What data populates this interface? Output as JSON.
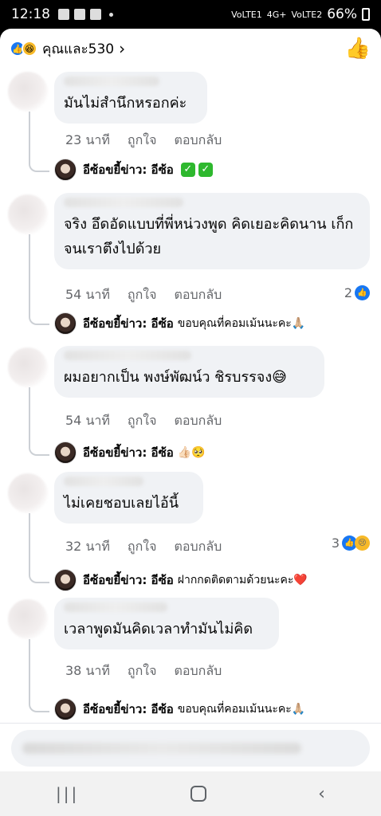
{
  "status_bar": {
    "time": "12:18",
    "network1": "VoLTE1",
    "network_type": "4G+",
    "network2": "VoLTE2",
    "battery": "66%"
  },
  "header": {
    "reactions_label": "คุณและ530"
  },
  "comments": [
    {
      "text": "มันไม่สำนึกหรอกค่ะ",
      "time": "23 นาที",
      "like": "ถูกใจ",
      "reply": "ตอบกลับ",
      "reaction_count": "",
      "author_reply": {
        "name": "อีซ้อขยี้ข่าว: อีซ้อ",
        "text": ""
      }
    },
    {
      "text": "จริง อึดอัดแบบที่พี่หน่วงพูด คิดเยอะคิดนาน เก็กจนเราตึงไปด้วย",
      "time": "54 นาที",
      "like": "ถูกใจ",
      "reply": "ตอบกลับ",
      "reaction_count": "2",
      "author_reply": {
        "name": "อีซ้อขยี้ข่าว: อีซ้อ",
        "text": "ขอบคุณที่คอมเม้นนะคะ🙏🏼"
      }
    },
    {
      "text": "ผมอยากเป็น พงษ์พัฒน์ว ชิรบรรจง😅",
      "time": "54 นาที",
      "like": "ถูกใจ",
      "reply": "ตอบกลับ",
      "reaction_count": "",
      "author_reply": {
        "name": "อีซ้อขยี้ข่าว: อีซ้อ",
        "text": "👍🏻🥺"
      }
    },
    {
      "text": "ไม่เคยชอบเลยไอ้นี้",
      "time": "32 นาที",
      "like": "ถูกใจ",
      "reply": "ตอบกลับ",
      "reaction_count": "3",
      "author_reply": {
        "name": "อีซ้อขยี้ข่าว: อีซ้อ",
        "text": "ฝากกดติดตามด้วยนะคะ❤️"
      }
    },
    {
      "text": "เวลาพูดมันคิดเวลาทำมันไม่คิด",
      "time": "38 นาที",
      "like": "ถูกใจ",
      "reply": "ตอบกลับ",
      "reaction_count": "",
      "author_reply": {
        "name": "อีซ้อขยี้ข่าว: อีซ้อ",
        "text": "ขอบคุณที่คอมเม้นนะคะ🙏🏼"
      }
    }
  ],
  "icons": {
    "like": "thumbs-up-icon",
    "haha": "haha-emoji-icon",
    "sad": "sad-emoji-icon",
    "check": "check-mark-icon"
  },
  "colors": {
    "accent": "#1877f2",
    "bubble": "#f0f2f5",
    "meta": "#65676b"
  }
}
